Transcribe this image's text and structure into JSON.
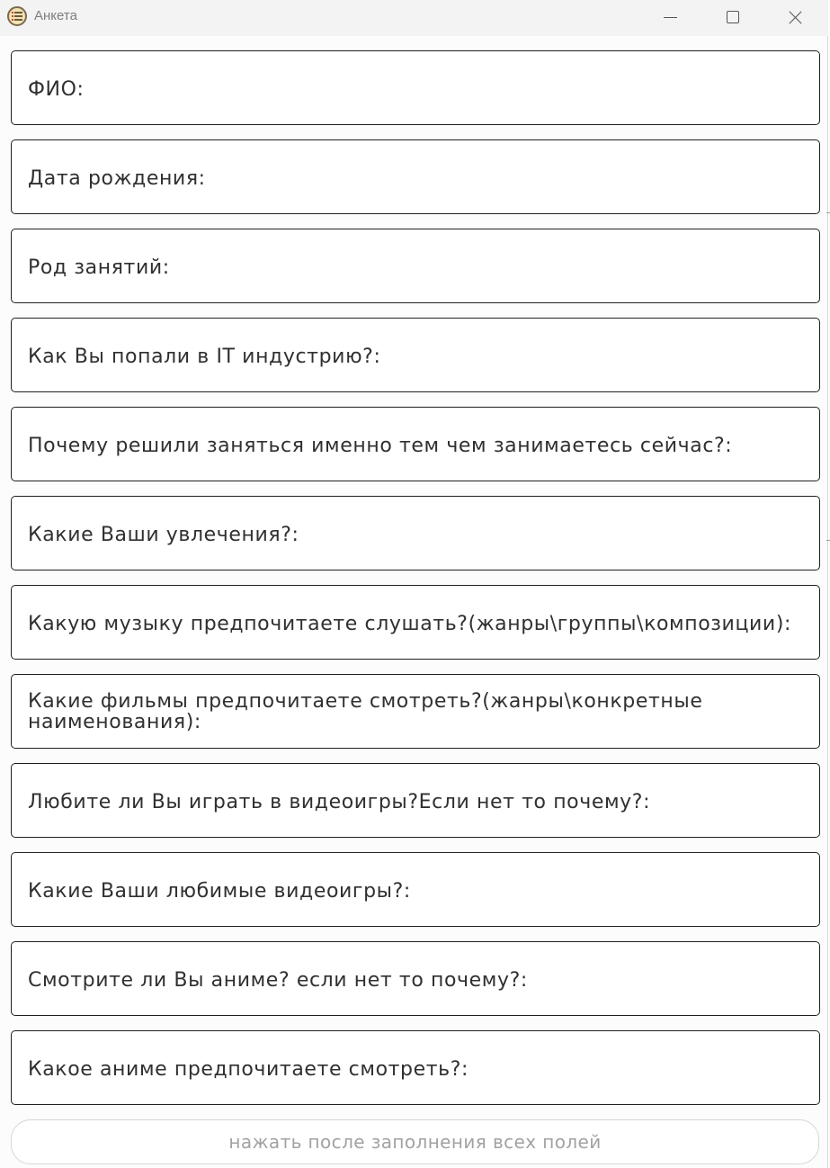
{
  "window": {
    "title": "Анкета"
  },
  "titlebar_buttons": {
    "minimize_icon": "minimize-icon",
    "maximize_icon": "maximize-icon",
    "close_icon": "close-icon"
  },
  "fields": [
    {
      "label": "ФИО:"
    },
    {
      "label": "Дата рождения:"
    },
    {
      "label": "Род занятий:"
    },
    {
      "label": "Как Вы попали в IT индустрию?:"
    },
    {
      "label": "Почему решили заняться именно тем чем занимаетесь сейчас?:"
    },
    {
      "label": "Какие Ваши увлечения?:"
    },
    {
      "label": "Какую музыку предпочитаете слушать?(жанры\\группы\\композиции):"
    },
    {
      "label": "Какие фильмы предпочитаете смотреть?(жанры\\конкретные наименования):"
    },
    {
      "label": "Любите ли Вы играть в видеоигры?Если нет то почему?:"
    },
    {
      "label": "Какие Ваши любимые видеоигры?:"
    },
    {
      "label": "Смотрите ли Вы аниме? если нет то почему?:"
    },
    {
      "label": "Какое аниме предпочитаете смотреть?:"
    }
  ],
  "submit": {
    "label": "нажать после заполнения всех полей",
    "state": "disabled"
  }
}
